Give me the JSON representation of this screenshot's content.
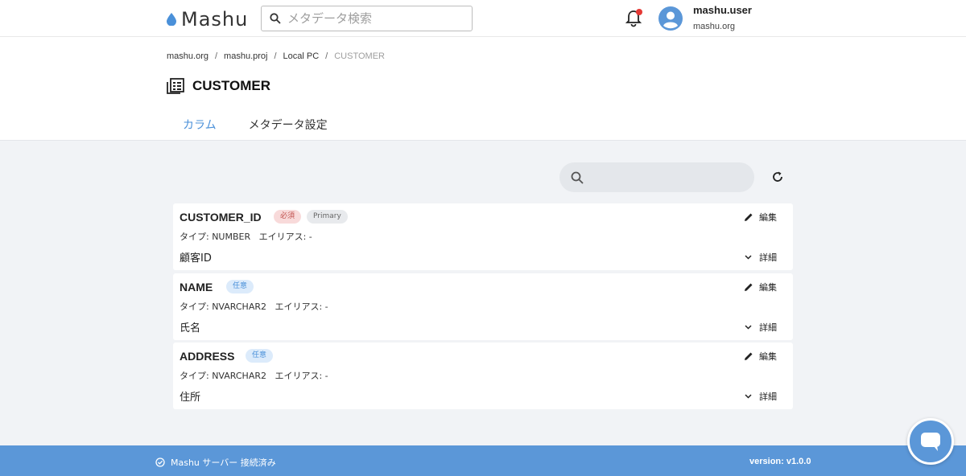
{
  "app": {
    "brand": "Mashu"
  },
  "header": {
    "search_placeholder": "メタデータ検索",
    "user_name": "mashu.user",
    "user_org": "mashu.org"
  },
  "breadcrumb": [
    {
      "label": "mashu.org"
    },
    {
      "label": "mashu.proj"
    },
    {
      "label": "Local PC"
    },
    {
      "label": "CUSTOMER"
    }
  ],
  "page": {
    "title": "CUSTOMER",
    "tabs": [
      {
        "label": "カラム",
        "active": true
      },
      {
        "label": "メタデータ設定",
        "active": false
      }
    ]
  },
  "columns": [
    {
      "name": "CUSTOMER_ID",
      "badges": [
        "必須",
        "Primary"
      ],
      "meta": "タイプ: NUMBER   エイリアス: -",
      "description": "顧客ID"
    },
    {
      "name": "NAME",
      "badges": [
        "任意"
      ],
      "meta": "タイプ: NVARCHAR2   エイリアス: -",
      "description": "氏名"
    },
    {
      "name": "ADDRESS",
      "badges": [
        "任意"
      ],
      "meta": "タイプ: NVARCHAR2   エイリアス: -",
      "description": "住所"
    }
  ],
  "actions": {
    "edit_label": "編集",
    "detail_label": "詳細"
  },
  "footer": {
    "status": "Mashu サーバー 接続済み",
    "version": "version: v1.0.0"
  },
  "colors": {
    "accent": "#4a90d9",
    "footer": "#5b97d8",
    "notification": "#e53935"
  }
}
